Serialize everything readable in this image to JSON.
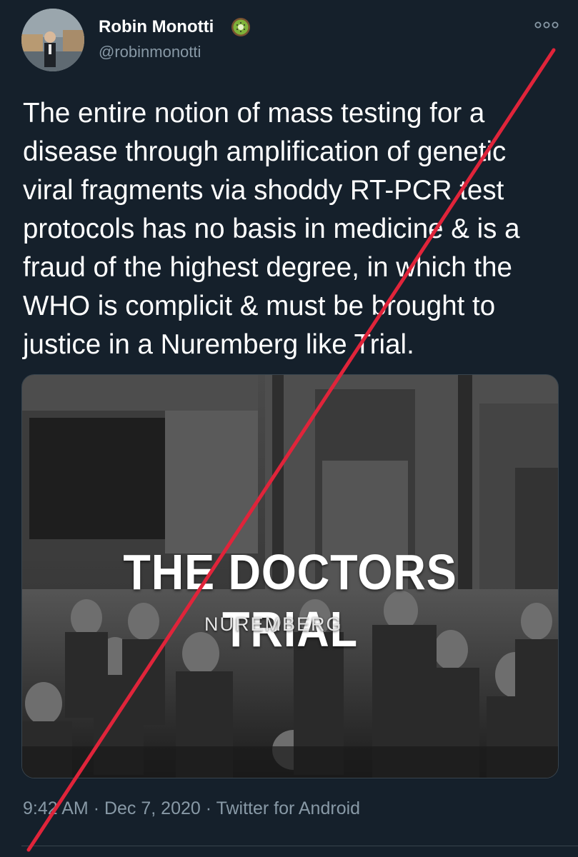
{
  "author": {
    "name": "Robin Monotti",
    "handle": "@robinmonotti",
    "badge_icon": "kiwi-emoji"
  },
  "tweet": {
    "lines": [
      "The entire notion of mass testing for a",
      "disease through amplification of genetic",
      "viral fragments via shoddy RT-PCR test",
      "protocols has no basis in medicine & is a",
      "fraud of the highest degree, in which the",
      "WHO is complicit & must be brought to",
      "justice in a Nuremberg like Trial."
    ]
  },
  "media": {
    "title": "THE DOCTORS TRIAL",
    "subtitle": "NUREMBERG"
  },
  "meta": {
    "time": "9:42 AM",
    "separator": "·",
    "date": "Dec 7, 2020",
    "source": "Twitter for Android"
  },
  "colors": {
    "background": "#15202b",
    "secondary_text": "#8899a6",
    "strike": "#e0243a"
  }
}
